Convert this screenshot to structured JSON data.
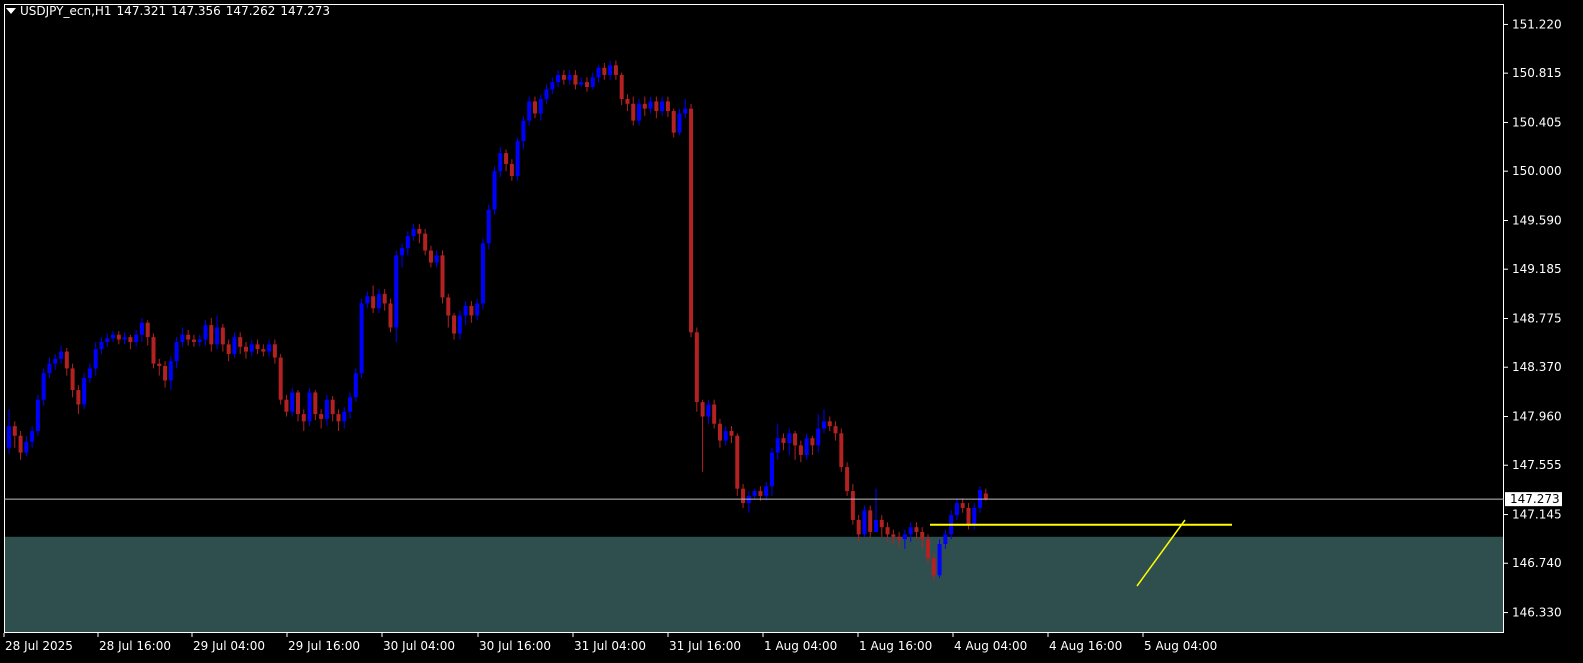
{
  "header": {
    "symbol": "USDJPY_ecn,H1",
    "open": "147.321",
    "high": "147.356",
    "low": "147.262",
    "close": "147.273"
  },
  "colors": {
    "background": "#000000",
    "bull": "#0000ff",
    "bear": "#b22222",
    "zone": "#2f4f4f",
    "trendline": "#ffff00",
    "price_line": "#c0c0c0",
    "frame": "#ffffff"
  },
  "chart_data": {
    "type": "candlestick",
    "ylim": [
      146.16,
      151.39
    ],
    "y_ticks": [
      "151.220",
      "150.815",
      "150.405",
      "150.000",
      "149.590",
      "149.185",
      "148.775",
      "148.370",
      "147.960",
      "147.555",
      "147.145",
      "146.740",
      "146.330"
    ],
    "x_ticks": [
      "28 Jul 2025",
      "28 Jul 16:00",
      "29 Jul 04:00",
      "29 Jul 16:00",
      "30 Jul 04:00",
      "30 Jul 16:00",
      "31 Jul 04:00",
      "31 Jul 16:00",
      "1 Aug 04:00",
      "1 Aug 16:00",
      "4 Aug 04:00",
      "4 Aug 16:00",
      "5 Aug 04:00"
    ],
    "current_price": "147.273",
    "current_price_value": 147.273,
    "candles": [
      [
        147.7,
        147.88,
        148.02,
        147.65
      ],
      [
        147.88,
        147.8,
        147.92,
        147.7
      ],
      [
        147.8,
        147.66,
        147.84,
        147.6
      ],
      [
        147.66,
        147.75,
        147.8,
        147.63
      ],
      [
        147.75,
        147.84,
        147.88,
        147.7
      ],
      [
        147.84,
        148.1,
        148.14,
        147.8
      ],
      [
        148.1,
        148.32,
        148.36,
        148.05
      ],
      [
        148.32,
        148.4,
        148.45,
        148.28
      ],
      [
        148.4,
        148.44,
        148.48,
        148.35
      ],
      [
        148.44,
        148.5,
        148.55,
        148.4
      ],
      [
        148.5,
        148.36,
        148.53,
        148.3
      ],
      [
        148.36,
        148.18,
        148.4,
        148.12
      ],
      [
        148.18,
        148.06,
        148.22,
        147.98
      ],
      [
        148.06,
        148.28,
        148.32,
        148.02
      ],
      [
        148.28,
        148.36,
        148.4,
        148.24
      ],
      [
        148.36,
        148.52,
        148.58,
        148.3
      ],
      [
        148.52,
        148.58,
        148.62,
        148.48
      ],
      [
        148.58,
        148.61,
        148.65,
        148.54
      ],
      [
        148.61,
        148.64,
        148.67,
        148.58
      ],
      [
        148.64,
        148.6,
        148.67,
        148.56
      ],
      [
        148.6,
        148.62,
        148.66,
        148.56
      ],
      [
        148.62,
        148.58,
        148.64,
        148.52
      ],
      [
        148.58,
        148.64,
        148.68,
        148.54
      ],
      [
        148.64,
        148.74,
        148.78,
        148.58
      ],
      [
        148.74,
        148.62,
        148.76,
        148.55
      ],
      [
        148.62,
        148.4,
        148.65,
        148.36
      ],
      [
        148.4,
        148.38,
        148.44,
        148.3
      ],
      [
        148.38,
        148.26,
        148.42,
        148.2
      ],
      [
        148.26,
        148.42,
        148.46,
        148.18
      ],
      [
        148.42,
        148.58,
        148.62,
        148.36
      ],
      [
        148.58,
        148.64,
        148.7,
        148.54
      ],
      [
        148.64,
        148.6,
        148.68,
        148.55
      ],
      [
        148.6,
        148.58,
        148.64,
        148.54
      ],
      [
        148.58,
        148.6,
        148.64,
        148.54
      ],
      [
        148.6,
        148.72,
        148.76,
        148.55
      ],
      [
        148.72,
        148.56,
        148.78,
        148.5
      ],
      [
        148.56,
        148.7,
        148.8,
        148.52
      ],
      [
        148.7,
        148.56,
        148.73,
        148.5
      ],
      [
        148.56,
        148.48,
        148.6,
        148.42
      ],
      [
        148.48,
        148.62,
        148.66,
        148.45
      ],
      [
        148.62,
        148.54,
        148.66,
        148.48
      ],
      [
        148.54,
        148.5,
        148.58,
        148.44
      ],
      [
        148.5,
        148.56,
        148.6,
        148.46
      ],
      [
        148.56,
        148.52,
        148.6,
        148.48
      ],
      [
        148.52,
        148.5,
        148.56,
        148.46
      ],
      [
        148.5,
        148.56,
        148.6,
        148.46
      ],
      [
        148.56,
        148.45,
        148.6,
        148.4
      ],
      [
        148.45,
        148.1,
        148.48,
        148.06
      ],
      [
        148.1,
        148.0,
        148.14,
        147.96
      ],
      [
        148.0,
        148.16,
        148.2,
        147.96
      ],
      [
        148.16,
        147.98,
        148.18,
        147.92
      ],
      [
        147.98,
        147.92,
        148.02,
        147.84
      ],
      [
        147.92,
        148.16,
        148.2,
        147.88
      ],
      [
        148.16,
        147.98,
        148.18,
        147.93
      ],
      [
        147.98,
        147.94,
        148.02,
        147.86
      ],
      [
        147.94,
        148.1,
        148.14,
        147.88
      ],
      [
        148.1,
        147.98,
        148.13,
        147.92
      ],
      [
        147.98,
        147.92,
        148.02,
        147.84
      ],
      [
        147.92,
        148.0,
        148.04,
        147.86
      ],
      [
        148.0,
        148.12,
        148.16,
        147.94
      ],
      [
        148.12,
        148.32,
        148.36,
        148.08
      ],
      [
        148.32,
        148.9,
        148.94,
        148.28
      ],
      [
        148.9,
        148.96,
        149.0,
        148.86
      ],
      [
        148.96,
        148.86,
        149.05,
        148.82
      ],
      [
        148.86,
        148.98,
        149.02,
        148.82
      ],
      [
        148.98,
        148.9,
        149.02,
        148.84
      ],
      [
        148.9,
        148.7,
        148.94,
        148.66
      ],
      [
        148.7,
        149.3,
        149.34,
        148.58
      ],
      [
        149.3,
        149.36,
        149.4,
        149.2
      ],
      [
        149.36,
        149.46,
        149.5,
        149.3
      ],
      [
        149.46,
        149.52,
        149.56,
        149.42
      ],
      [
        149.52,
        149.48,
        149.56,
        149.4
      ],
      [
        149.48,
        149.34,
        149.52,
        149.3
      ],
      [
        149.34,
        149.24,
        149.38,
        149.2
      ],
      [
        149.24,
        149.3,
        149.34,
        149.2
      ],
      [
        149.3,
        148.95,
        149.34,
        148.9
      ],
      [
        148.95,
        148.8,
        148.98,
        148.7
      ],
      [
        148.8,
        148.65,
        148.82,
        148.6
      ],
      [
        148.65,
        148.8,
        148.84,
        148.6
      ],
      [
        148.8,
        148.88,
        148.92,
        148.72
      ],
      [
        148.88,
        148.8,
        148.92,
        148.74
      ],
      [
        148.8,
        148.9,
        148.94,
        148.76
      ],
      [
        148.9,
        149.4,
        149.44,
        148.85
      ],
      [
        149.4,
        149.68,
        149.72,
        149.35
      ],
      [
        149.68,
        150.0,
        150.04,
        149.64
      ],
      [
        150.0,
        150.15,
        150.2,
        149.95
      ],
      [
        150.15,
        150.06,
        150.18,
        150.0
      ],
      [
        150.06,
        149.96,
        150.1,
        149.92
      ],
      [
        149.96,
        150.25,
        150.28,
        149.92
      ],
      [
        150.25,
        150.42,
        150.46,
        150.18
      ],
      [
        150.42,
        150.58,
        150.62,
        150.38
      ],
      [
        150.58,
        150.48,
        150.62,
        150.44
      ],
      [
        150.48,
        150.6,
        150.64,
        150.42
      ],
      [
        150.6,
        150.68,
        150.72,
        150.56
      ],
      [
        150.68,
        150.74,
        150.78,
        150.64
      ],
      [
        150.74,
        150.8,
        150.84,
        150.7
      ],
      [
        150.8,
        150.76,
        150.84,
        150.72
      ],
      [
        150.76,
        150.8,
        150.84,
        150.72
      ],
      [
        150.8,
        150.72,
        150.84,
        150.68
      ],
      [
        150.72,
        150.74,
        150.78,
        150.7
      ],
      [
        150.74,
        150.7,
        150.78,
        150.66
      ],
      [
        150.7,
        150.78,
        150.82,
        150.68
      ],
      [
        150.78,
        150.86,
        150.88,
        150.74
      ],
      [
        150.86,
        150.8,
        150.9,
        150.76
      ],
      [
        150.8,
        150.88,
        150.92,
        150.76
      ],
      [
        150.88,
        150.8,
        150.92,
        150.76
      ],
      [
        150.8,
        150.6,
        150.82,
        150.55
      ],
      [
        150.6,
        150.56,
        150.64,
        150.5
      ],
      [
        150.56,
        150.42,
        150.62,
        150.38
      ],
      [
        150.42,
        150.56,
        150.6,
        150.38
      ],
      [
        150.56,
        150.52,
        150.62,
        150.46
      ],
      [
        150.52,
        150.58,
        150.62,
        150.48
      ],
      [
        150.58,
        150.5,
        150.62,
        150.44
      ],
      [
        150.5,
        150.58,
        150.62,
        150.46
      ],
      [
        150.58,
        150.5,
        150.62,
        150.45
      ],
      [
        150.5,
        150.32,
        150.52,
        150.28
      ],
      [
        150.32,
        150.48,
        150.52,
        150.3
      ],
      [
        150.48,
        150.52,
        150.6,
        150.44
      ],
      [
        150.52,
        148.66,
        150.56,
        148.62
      ],
      [
        148.66,
        148.08,
        148.7,
        148.0
      ],
      [
        148.08,
        147.96,
        148.1,
        147.5
      ],
      [
        147.96,
        148.06,
        148.1,
        147.9
      ],
      [
        148.06,
        147.9,
        148.1,
        147.86
      ],
      [
        147.9,
        147.76,
        147.94,
        147.7
      ],
      [
        147.76,
        147.84,
        147.88,
        147.72
      ],
      [
        147.84,
        147.8,
        147.88,
        147.74
      ],
      [
        147.8,
        147.36,
        147.82,
        147.3
      ],
      [
        147.36,
        147.24,
        147.4,
        147.2
      ],
      [
        147.24,
        147.3,
        147.34,
        147.16
      ],
      [
        147.3,
        147.34,
        147.36,
        147.28
      ],
      [
        147.34,
        147.3,
        147.38,
        147.26
      ],
      [
        147.3,
        147.38,
        147.42,
        147.26
      ],
      [
        147.38,
        147.66,
        147.7,
        147.3
      ],
      [
        147.66,
        147.78,
        147.9,
        147.6
      ],
      [
        147.78,
        147.74,
        147.82,
        147.68
      ],
      [
        147.74,
        147.82,
        147.86,
        147.64
      ],
      [
        147.82,
        147.72,
        147.84,
        147.6
      ],
      [
        147.72,
        147.64,
        147.76,
        147.58
      ],
      [
        147.64,
        147.78,
        147.82,
        147.6
      ],
      [
        147.78,
        147.72,
        147.8,
        147.64
      ],
      [
        147.72,
        147.86,
        147.98,
        147.66
      ],
      [
        147.86,
        147.92,
        148.02,
        147.82
      ],
      [
        147.92,
        147.88,
        147.96,
        147.84
      ],
      [
        147.88,
        147.82,
        147.92,
        147.76
      ],
      [
        147.82,
        147.54,
        147.86,
        147.5
      ],
      [
        147.54,
        147.34,
        147.58,
        147.3
      ],
      [
        147.34,
        147.1,
        147.4,
        147.06
      ],
      [
        147.1,
        146.98,
        147.14,
        146.92
      ],
      [
        146.98,
        147.18,
        147.22,
        146.96
      ],
      [
        147.18,
        147.0,
        147.22,
        146.95
      ],
      [
        147.0,
        147.1,
        147.36,
        147.02
      ],
      [
        147.1,
        147.04,
        147.14,
        146.96
      ],
      [
        147.04,
        146.98,
        147.08,
        146.92
      ],
      [
        146.98,
        146.96,
        147.02,
        146.9
      ],
      [
        146.96,
        146.94,
        147.0,
        146.88
      ],
      [
        146.94,
        146.98,
        147.02,
        146.86
      ],
      [
        146.98,
        147.04,
        147.08,
        146.92
      ],
      [
        147.04,
        147.0,
        147.08,
        146.94
      ],
      [
        147.0,
        146.94,
        147.04,
        146.86
      ],
      [
        146.94,
        146.78,
        146.98,
        146.74
      ],
      [
        146.78,
        146.64,
        146.82,
        146.6
      ],
      [
        146.64,
        146.9,
        146.94,
        146.62
      ],
      [
        146.9,
        146.98,
        147.02,
        146.86
      ],
      [
        146.98,
        147.14,
        147.18,
        146.94
      ],
      [
        147.14,
        147.24,
        147.28,
        147.1
      ],
      [
        147.24,
        147.2,
        147.28,
        147.16
      ],
      [
        147.2,
        147.06,
        147.24,
        147.02
      ],
      [
        147.06,
        147.2,
        147.24,
        147.02
      ],
      [
        147.2,
        147.35,
        147.38,
        147.16
      ],
      [
        147.32,
        147.27,
        147.36,
        147.26
      ]
    ],
    "trendline_points": [
      [
        1137,
        586
      ],
      [
        1185,
        520
      ]
    ],
    "support_line": {
      "y": 147.06,
      "x_from": 930,
      "x_to": 1232
    },
    "zone": {
      "y_top": 146.96
    }
  }
}
